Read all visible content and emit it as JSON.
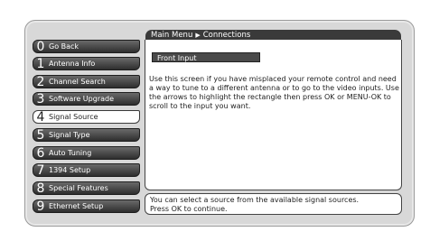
{
  "breadcrumb": {
    "root": "Main Menu",
    "current": "Connections"
  },
  "menu": {
    "items": [
      {
        "num": "0",
        "label": "Go Back"
      },
      {
        "num": "1",
        "label": "Antenna Info"
      },
      {
        "num": "2",
        "label": "Channel Search"
      },
      {
        "num": "3",
        "label": "Software Upgrade"
      },
      {
        "num": "4",
        "label": "Signal Source"
      },
      {
        "num": "5",
        "label": "Signal Type"
      },
      {
        "num": "6",
        "label": "Auto Tuning"
      },
      {
        "num": "7",
        "label": "1394 Setup"
      },
      {
        "num": "8",
        "label": "Special Features"
      },
      {
        "num": "9",
        "label": "Ethernet Setup"
      }
    ],
    "selected": "Signal Source"
  },
  "content": {
    "selected_input": "Front Input",
    "description": "Use this screen if you have misplaced your remote control and need a way to tune to a different antenna or to go to the video inputs. Use the arrows to highlight the rectangle then press OK or MENU-OK to scroll to the input you want."
  },
  "help": {
    "line1": "You can select a source from the available signal sources.",
    "line2": "Press OK to continue."
  }
}
